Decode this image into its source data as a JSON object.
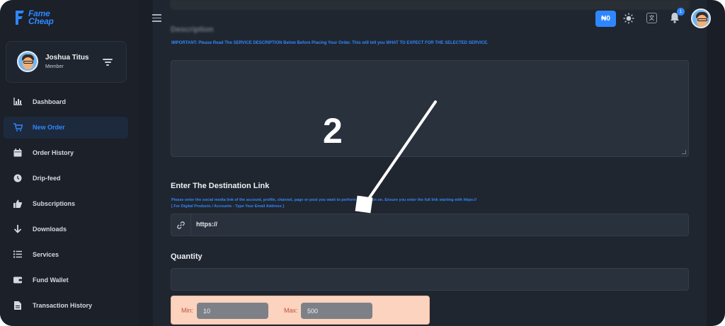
{
  "brand": {
    "line1": "Fame",
    "line2": "Cheap"
  },
  "profile": {
    "name": "Joshua Titus",
    "role": "Member"
  },
  "sidebar": {
    "items": [
      {
        "label": "Dashboard",
        "icon": "chart-icon"
      },
      {
        "label": "New Order",
        "icon": "cart-icon",
        "active": true
      },
      {
        "label": "Order History",
        "icon": "calendar-icon"
      },
      {
        "label": "Drip-feed",
        "icon": "clock-icon"
      },
      {
        "label": "Subscriptions",
        "icon": "thumbs-up-icon"
      },
      {
        "label": "Downloads",
        "icon": "arrow-down-icon"
      },
      {
        "label": "Services",
        "icon": "list-icon"
      },
      {
        "label": "Fund Wallet",
        "icon": "wallet-icon"
      },
      {
        "label": "Transaction History",
        "icon": "document-icon"
      }
    ]
  },
  "topbar": {
    "wallet": "₦0",
    "lang": "文",
    "notifications": "1"
  },
  "form": {
    "description_label": "Description",
    "important_note": "IMPORTANT: Please Read The SERVICE DESCRIPTION Below Before Placing Your Order. This will tell you WHAT TO EXPECT FOR THE SELECTED SERVICE.",
    "destination_title": "Enter The Destination Link",
    "destination_help": "Please enter the social media link of the account, profile, channel, page or post you want to perform this action on. Ensure you enter the full link starting with https://",
    "destination_help2": "[ For Digital Products / Accounts - Type Your Email Address ]",
    "link_value": "https://",
    "quantity_title": "Quantity",
    "min_label": "Min:",
    "min_value": "10",
    "max_label": "Max:",
    "max_value": "500"
  },
  "annotation": {
    "step": "2"
  },
  "colors": {
    "accent": "#2f87ff",
    "sidebar": "#1b2029",
    "panel": "#20262f",
    "minmax_bg": "#fbd3bf"
  }
}
